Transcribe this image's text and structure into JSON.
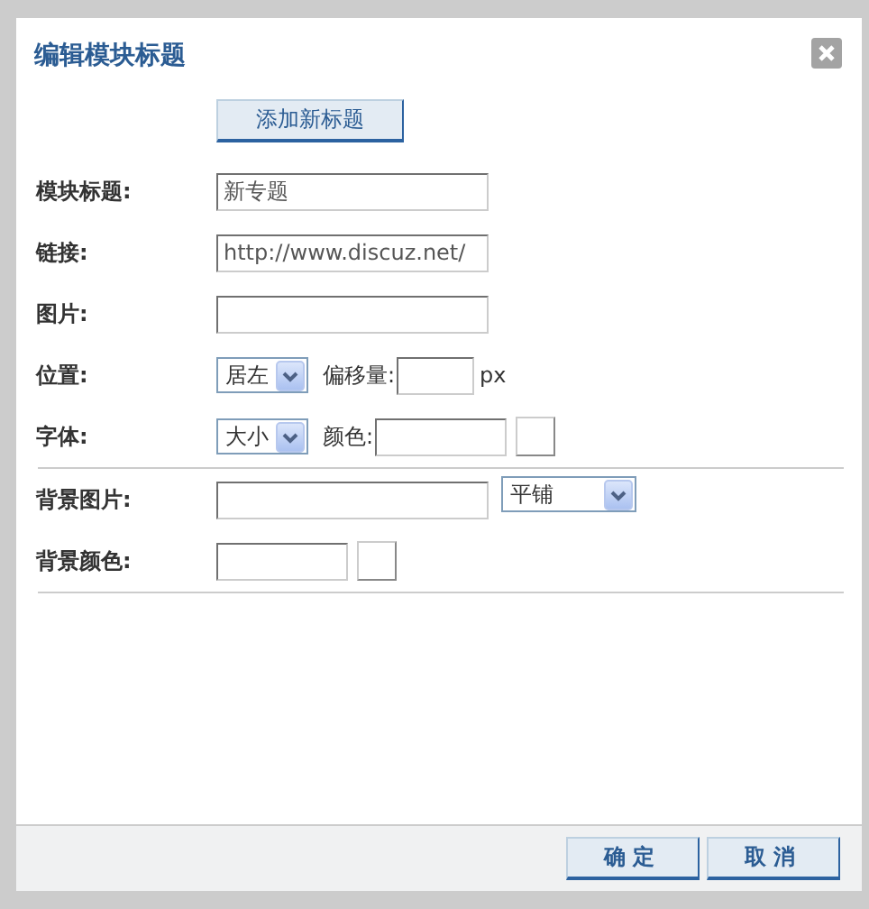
{
  "dialog": {
    "title": "编辑模块标题",
    "add_button": "添加新标题",
    "rows": [
      {
        "kind": "field",
        "label": "模块标题:",
        "controls": [
          {
            "kind": "wide-input",
            "value": "新专题"
          }
        ]
      },
      {
        "kind": "field",
        "label": "链接:",
        "controls": [
          {
            "kind": "wide-input",
            "value": "http://www.discuz.net/"
          }
        ]
      },
      {
        "kind": "field",
        "label": "图片:",
        "controls": [
          {
            "kind": "wide-input"
          }
        ]
      },
      {
        "kind": "field",
        "label": "位置:",
        "controls": [
          {
            "kind": "select",
            "value": "居左"
          },
          {
            "kind": "caption",
            "text": "偏移量:"
          },
          {
            "kind": "small-input"
          },
          {
            "kind": "caption",
            "text": "px"
          }
        ]
      },
      {
        "kind": "field",
        "label": "字体:",
        "controls": [
          {
            "kind": "select",
            "value": "大小"
          },
          {
            "kind": "caption",
            "text": "颜色:"
          },
          {
            "kind": "narrow-input"
          },
          {
            "kind": "swatch"
          }
        ]
      },
      {
        "kind": "divider"
      },
      {
        "kind": "field",
        "label": "背景图片:",
        "controls": [
          {
            "kind": "wide-input"
          },
          {
            "kind": "wide-select",
            "value": "平铺"
          }
        ]
      },
      {
        "kind": "field",
        "label": "背景颜色:",
        "controls": [
          {
            "kind": "narrow-input"
          },
          {
            "kind": "swatch"
          }
        ]
      },
      {
        "kind": "divider"
      }
    ],
    "buttons": [
      "确定",
      "取消"
    ]
  }
}
